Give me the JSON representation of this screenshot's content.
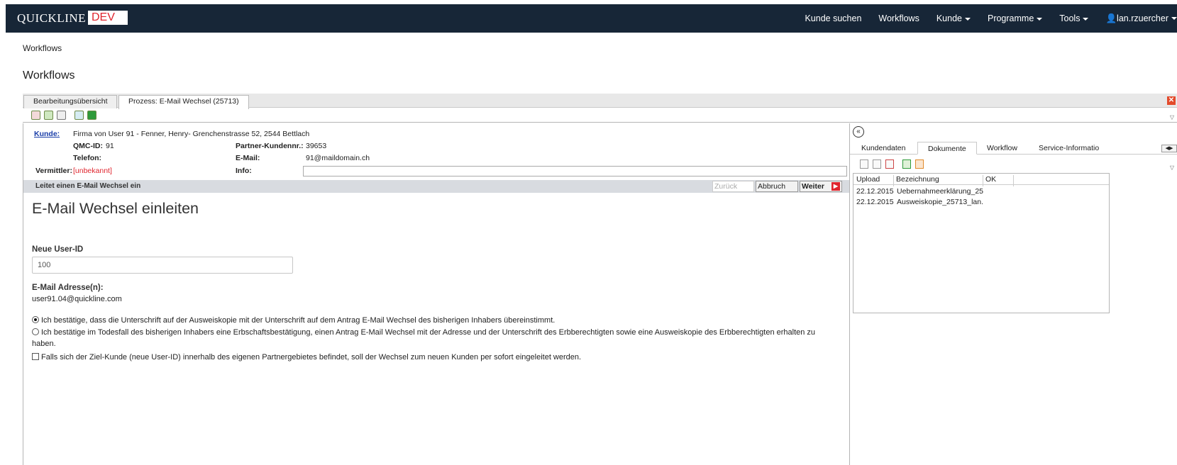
{
  "app": {
    "logo_text": "QUICKLINE",
    "env_badge": "DEV"
  },
  "nav": {
    "items": [
      {
        "label": "Kunde suchen",
        "dropdown": false
      },
      {
        "label": "Workflows",
        "dropdown": false
      },
      {
        "label": "Kunde",
        "dropdown": true
      },
      {
        "label": "Programme",
        "dropdown": true
      },
      {
        "label": "Tools",
        "dropdown": true
      }
    ],
    "user": "lan.rzuercher"
  },
  "breadcrumb": "Workflows",
  "page_title": "Workflows",
  "tabs": [
    "Bearbeitungsübersicht",
    "Prozess: E-Mail Wechsel (25713)"
  ],
  "customer": {
    "kunde_label": "Kunde:",
    "kunde_value": "Firma von User 91 - Fenner, Henry- Grenchenstrasse 52, 2544 Bettlach",
    "qmc_label": "QMC-ID:",
    "qmc_value": "91",
    "partner_label": "Partner-Kundennr.:",
    "partner_value": "39653",
    "telefon_label": "Telefon:",
    "telefon_value": "",
    "email_label": "E-Mail:",
    "email_value": "91@maildomain.ch",
    "vermittler_label": "Vermittler:",
    "vermittler_value": "[unbekannt]",
    "info_label": "Info:",
    "info_value": ""
  },
  "step": {
    "description": "Leitet einen E-Mail Wechsel ein",
    "back_label": "Zurück",
    "cancel_label": "Abbruch",
    "next_label": "Weiter"
  },
  "form": {
    "heading": "E-Mail Wechsel einleiten",
    "user_id_label": "Neue User-ID",
    "user_id_value": "100",
    "emails_label": "E-Mail Adresse(n):",
    "emails_value": "user91.04@quickline.com",
    "option1": "Ich bestätige, dass die Unterschrift auf der Ausweiskopie mit der Unterschrift auf dem Antrag E-Mail Wechsel des bisherigen Inhabers übereinstimmt.",
    "option1_selected": true,
    "option2": "Ich bestätige im Todesfall des bisherigen Inhabers eine Erbschaftsbestätigung, einen Antrag E-Mail Wechsel mit der Adresse und der Unterschrift des Erbberechtigten sowie eine Ausweiskopie des Erbberechtigten erhalten zu haben.",
    "option2_selected": false,
    "checkbox_label": "Falls sich der Ziel-Kunde (neue User-ID) innerhalb des eigenen Partnergebietes befindet, soll der Wechsel zum neuen Kunden per sofort eingeleitet werden.",
    "checkbox_checked": false
  },
  "side": {
    "tabs": [
      "Kundendaten",
      "Dokumente",
      "Workflow",
      "Service-Informatio"
    ],
    "active_tab": "Dokumente",
    "columns": [
      "Upload",
      "Bezeichnung",
      "OK"
    ],
    "documents": [
      {
        "upload": "22.12.2015",
        "name": "Uebernahmeerklärung_25",
        "ok": ""
      },
      {
        "upload": "22.12.2015",
        "name": "Ausweiskopie_25713_lan.",
        "ok": ""
      }
    ]
  }
}
